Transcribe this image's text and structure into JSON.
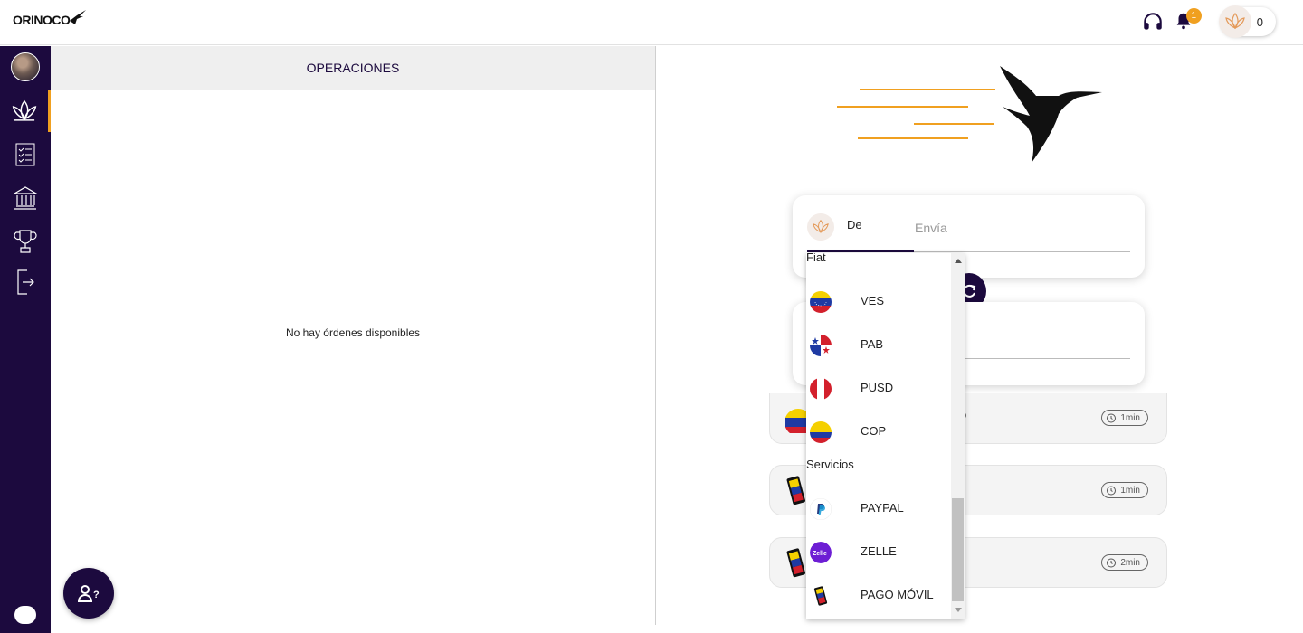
{
  "brand": {
    "name": "ORINOCO"
  },
  "topbar": {
    "notification_count": "1",
    "balance": "0"
  },
  "operations": {
    "title": "OPERACIONES",
    "empty_message": "No hay órdenes disponibles"
  },
  "exchange": {
    "from_tab": "De",
    "to_tab": "Envía"
  },
  "dropdown": {
    "groups": [
      {
        "label": "Fiat",
        "items": [
          "VES",
          "PAB",
          "PUSD",
          "COP"
        ]
      },
      {
        "label": "Servicios",
        "items": [
          "PAYPAL",
          "ZELLE",
          "PAGO MÓVIL"
        ]
      }
    ]
  },
  "recent": [
    {
      "text": "o",
      "time": "1min"
    },
    {
      "text": "",
      "time": "1min"
    },
    {
      "text": "",
      "time": "2min"
    }
  ],
  "colors": {
    "primary": "#1c0a3e",
    "accent": "#f0a020"
  }
}
